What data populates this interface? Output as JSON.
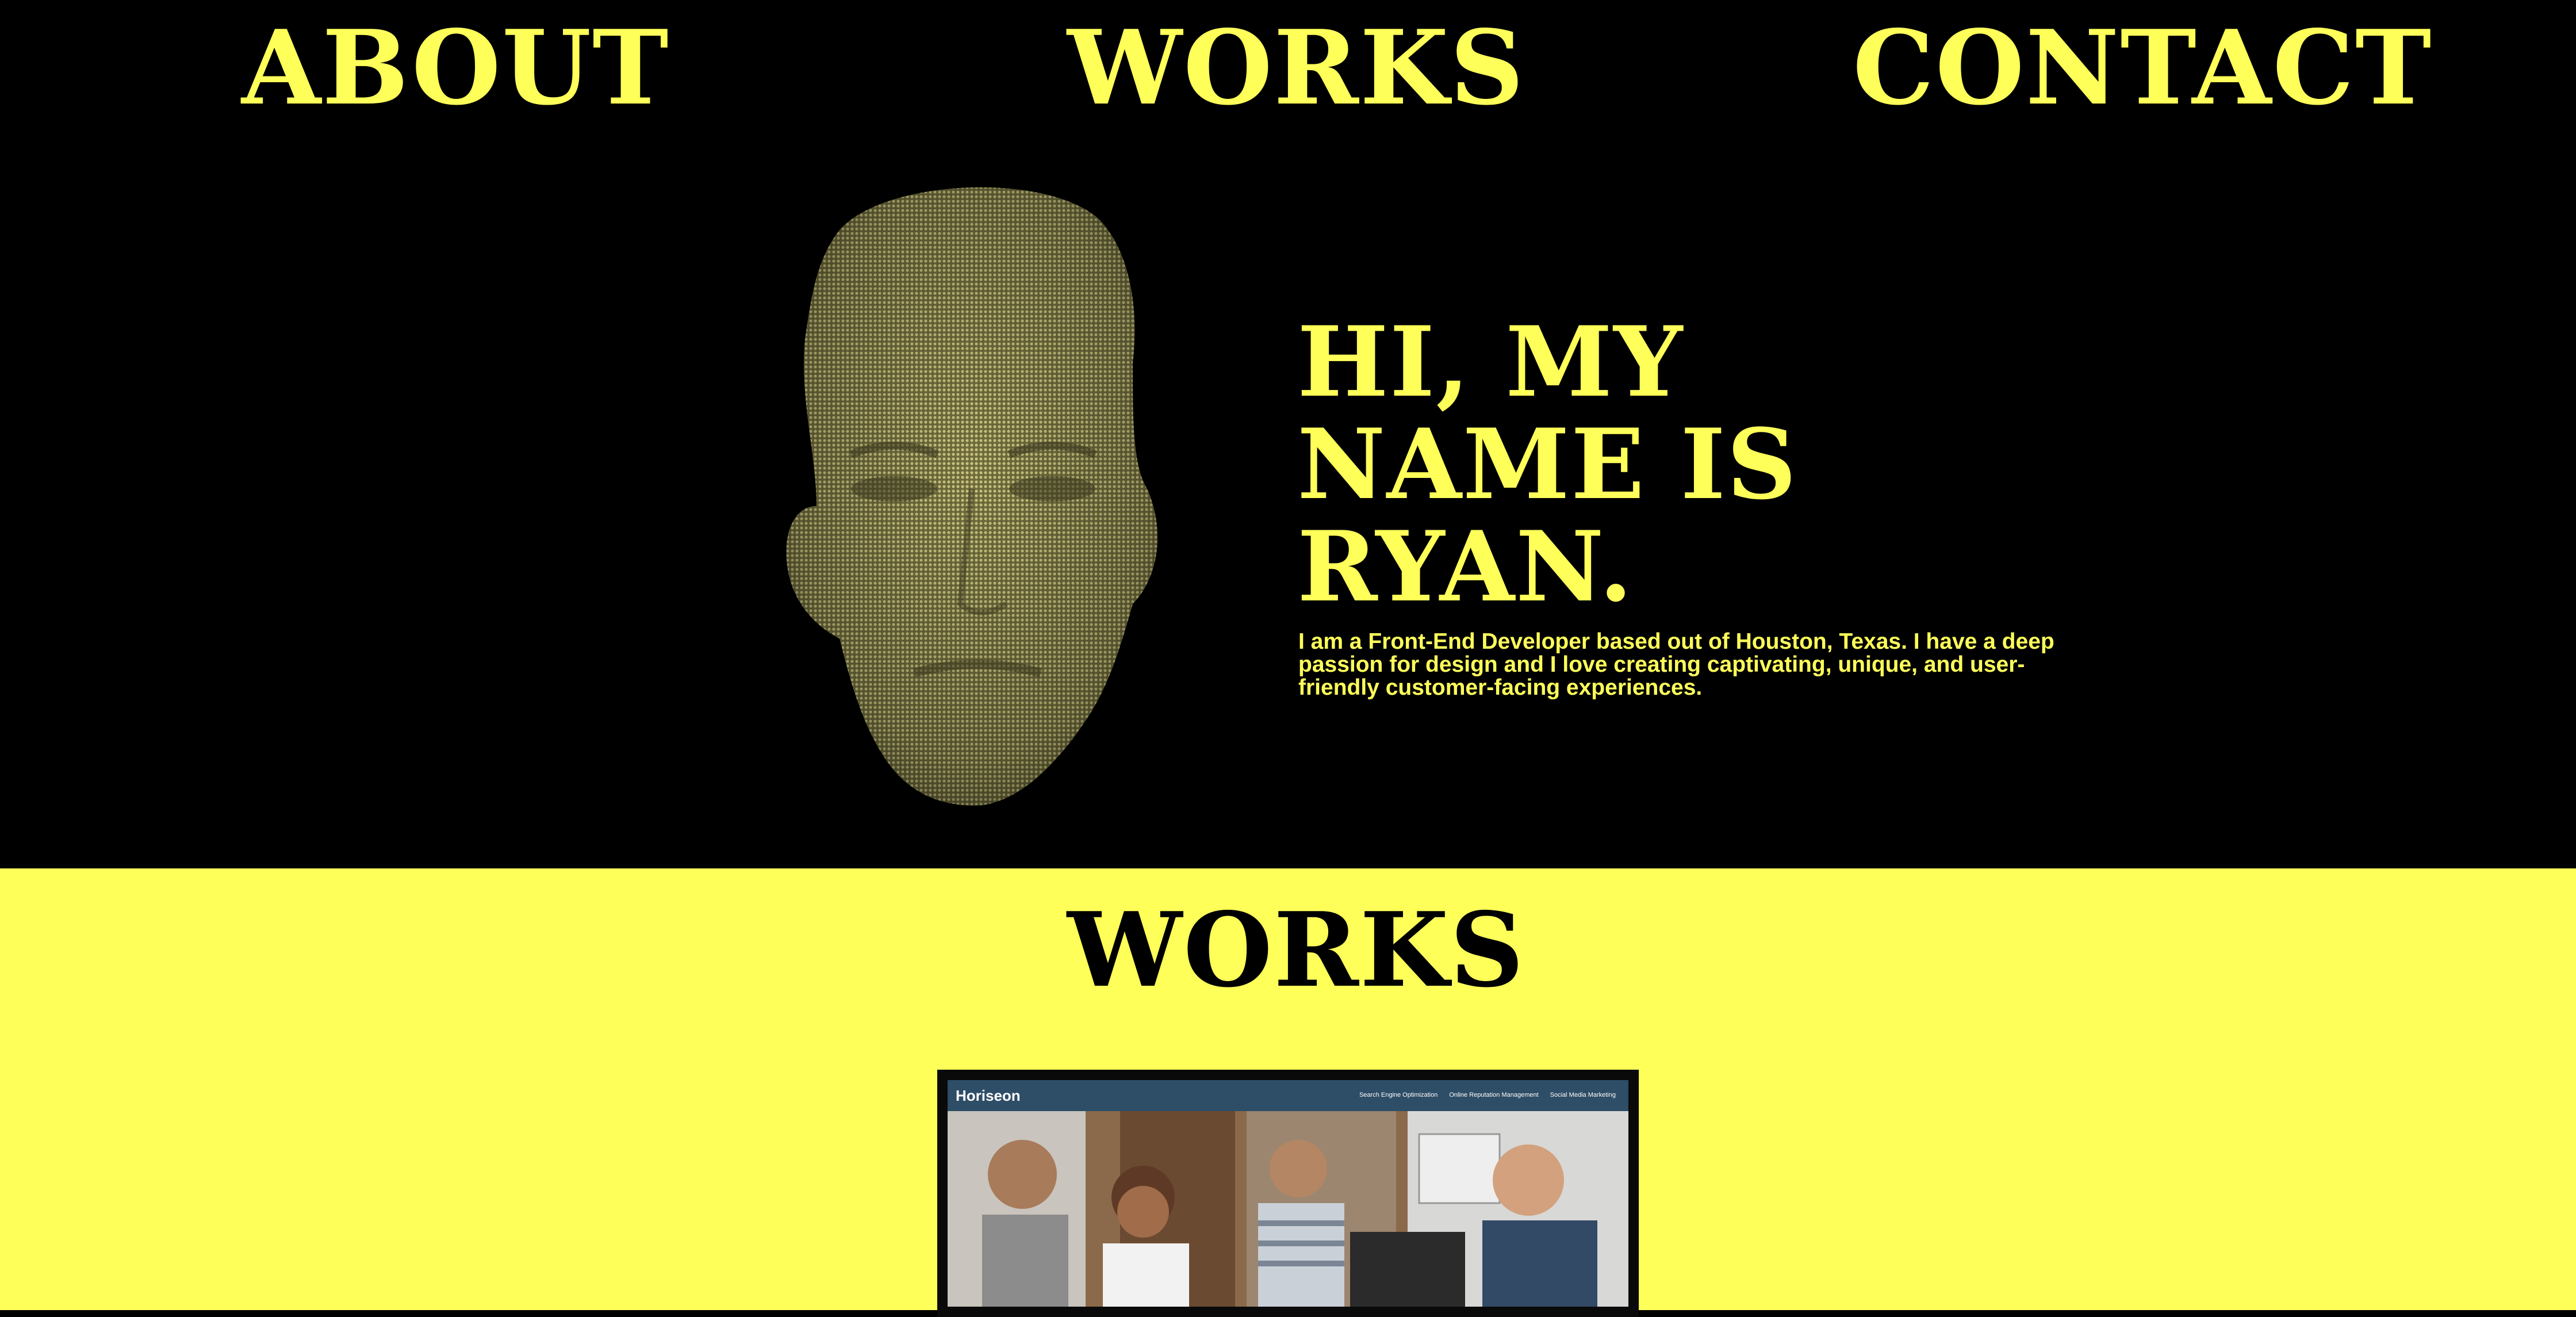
{
  "colors": {
    "accent": "#ffff5a",
    "background": "#000000",
    "text_dark": "#000000"
  },
  "nav": {
    "about": "ABOUT",
    "works": "WORKS",
    "contact": "CONTACT"
  },
  "hero": {
    "heading_lines": [
      "HI, MY",
      "NAME IS",
      "RYAN."
    ],
    "intro": "I am a Front-End Developer based out of Houston, Texas. I have a deep passion for design and I love creating captivating, unique, and user-friendly customer-facing experiences."
  },
  "works": {
    "title": "WORKS",
    "projects": [
      {
        "brand": "Horiseon",
        "nav_items": [
          "Search Engine Optimization",
          "Online Reputation Management",
          "Social Media Marketing"
        ]
      }
    ]
  }
}
